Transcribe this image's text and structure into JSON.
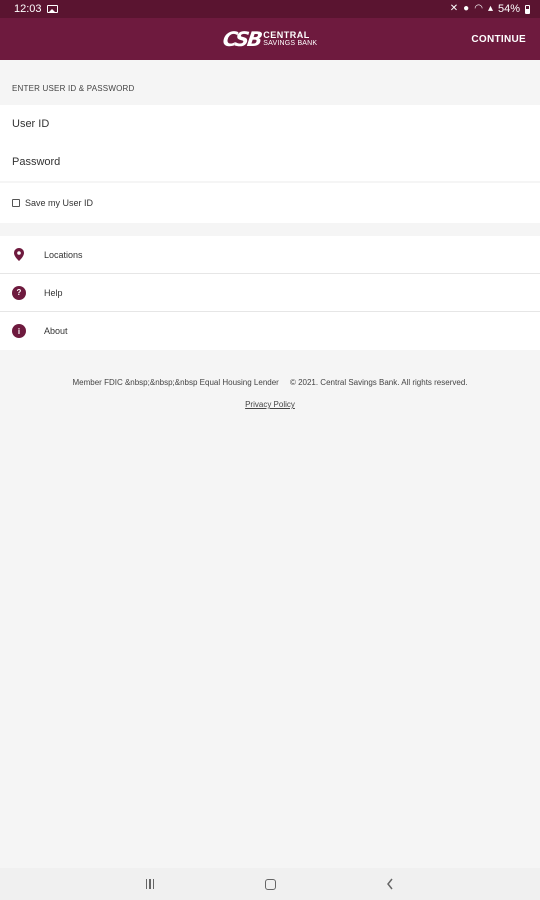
{
  "status_bar": {
    "time": "12:03",
    "battery": "54%"
  },
  "header": {
    "logo_mark": "CSB",
    "logo_line1": "CENTRAL",
    "logo_line2": "SAVINGS BANK",
    "continue_label": "CONTINUE"
  },
  "login": {
    "section_label": "ENTER USER ID & PASSWORD",
    "userid_placeholder": "User ID",
    "password_placeholder": "Password",
    "save_label": "Save my User ID"
  },
  "menu": {
    "items": [
      {
        "label": "Locations",
        "icon": "location-pin-icon"
      },
      {
        "label": "Help",
        "icon": "help-icon",
        "glyph": "?"
      },
      {
        "label": "About",
        "icon": "info-icon",
        "glyph": "i"
      }
    ]
  },
  "footer": {
    "text": "Member FDIC &nbsp;&nbsp;&nbsp Equal Housing Lender     © 2021. Central Savings Bank. All rights reserved.",
    "privacy_label": "Privacy Policy"
  },
  "colors": {
    "brand": "#6e1a3e",
    "status_bar": "#5a1430",
    "background": "#f5f5f5"
  }
}
